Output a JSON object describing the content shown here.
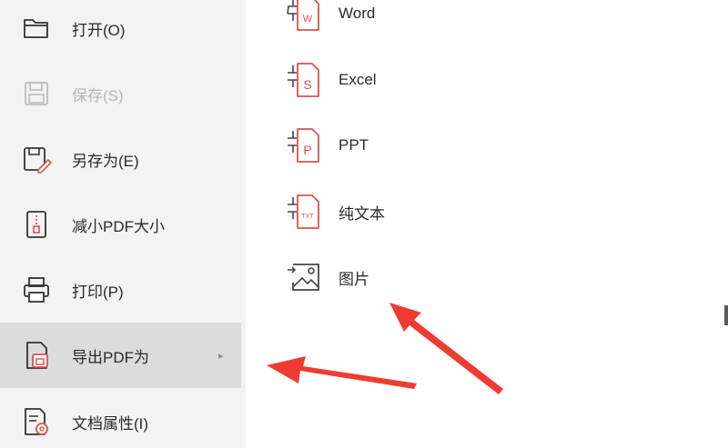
{
  "left_menu": {
    "items": [
      {
        "label": "打开(O)",
        "icon": "folder-open-icon"
      },
      {
        "label": "保存(S)",
        "icon": "save-icon",
        "disabled": true
      },
      {
        "label": "另存为(E)",
        "icon": "save-as-icon"
      },
      {
        "label": "减小PDF大小",
        "icon": "compress-pdf-icon"
      },
      {
        "label": "打印(P)",
        "icon": "printer-icon"
      },
      {
        "label": "导出PDF为",
        "icon": "export-pdf-icon",
        "active": true,
        "has_submenu": true
      },
      {
        "label": "文档属性(I)",
        "icon": "document-properties-icon"
      }
    ],
    "submenu_chevron": "▸"
  },
  "export_submenu": {
    "items": [
      {
        "label": "Word",
        "icon": "word-export-icon",
        "glyph": "W"
      },
      {
        "label": "Excel",
        "icon": "excel-export-icon",
        "glyph": "S"
      },
      {
        "label": "PPT",
        "icon": "ppt-export-icon",
        "glyph": "P"
      },
      {
        "label": "纯文本",
        "icon": "txt-export-icon",
        "glyph": "TXT"
      },
      {
        "label": "图片",
        "icon": "image-export-icon"
      }
    ]
  },
  "colors": {
    "accent": "#d9534f",
    "annotation_arrow": "#ef3b32",
    "menu_background": "#f3f3f3",
    "active_item_background": "#dcdcdc"
  }
}
